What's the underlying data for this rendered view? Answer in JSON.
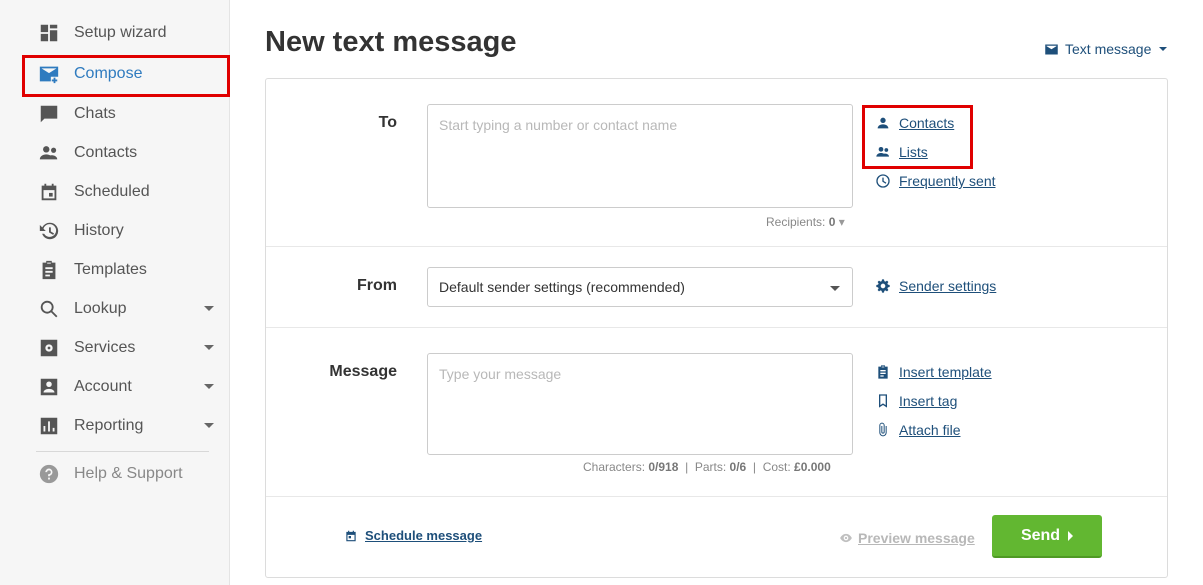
{
  "sidebar": {
    "items": [
      {
        "label": "Setup wizard",
        "icon": "dashboard-icon"
      },
      {
        "label": "Compose",
        "icon": "compose-mail-icon"
      },
      {
        "label": "Chats",
        "icon": "chat-icon"
      },
      {
        "label": "Contacts",
        "icon": "people-icon"
      },
      {
        "label": "Scheduled",
        "icon": "calendar-icon"
      },
      {
        "label": "History",
        "icon": "history-icon"
      },
      {
        "label": "Templates",
        "icon": "clipboard-icon"
      },
      {
        "label": "Lookup",
        "icon": "search-icon"
      },
      {
        "label": "Services",
        "icon": "gear-box-icon"
      },
      {
        "label": "Account",
        "icon": "account-box-icon"
      },
      {
        "label": "Reporting",
        "icon": "bar-chart-icon"
      }
    ],
    "help": {
      "label": "Help & Support",
      "icon": "help-circle-icon"
    }
  },
  "page": {
    "title": "New text message",
    "type_switch": "Text message"
  },
  "to": {
    "label": "To",
    "placeholder": "Start typing a number or contact name",
    "recipients_label": "Recipients:",
    "recipients_value": "0",
    "links": {
      "contacts": "Contacts",
      "lists": "Lists",
      "frequently_sent": "Frequently sent"
    }
  },
  "from": {
    "label": "From",
    "selected": "Default sender settings (recommended)",
    "sender_settings": "Sender settings"
  },
  "message": {
    "label": "Message",
    "placeholder": "Type your message",
    "links": {
      "insert_template": "Insert template",
      "insert_tag": "Insert tag",
      "attach_file": "Attach file"
    },
    "stats": {
      "characters_label": "Characters:",
      "characters_value": "0/918",
      "parts_label": "Parts:",
      "parts_value": "0/6",
      "cost_label": "Cost:",
      "cost_value": "£0.000"
    }
  },
  "footer": {
    "schedule": "Schedule message",
    "preview": "Preview message",
    "send": "Send"
  },
  "colors": {
    "accent": "#2f7bbf",
    "link": "#1e4f7a",
    "send_green": "#62b731",
    "highlight_red": "#e00000"
  }
}
